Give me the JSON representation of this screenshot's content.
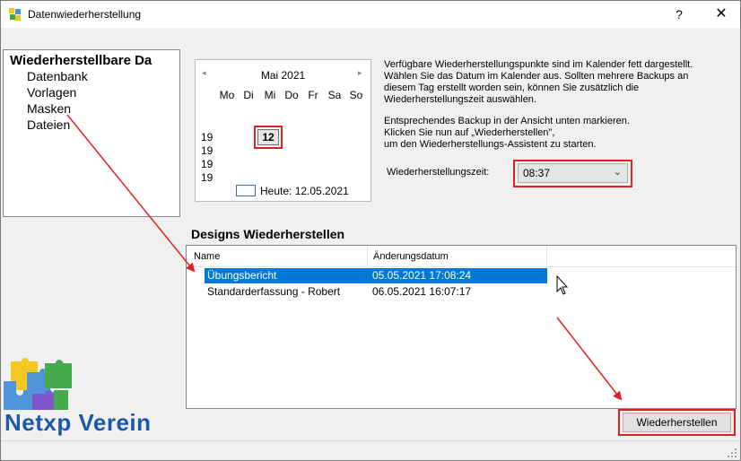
{
  "window": {
    "title": "Datenwiederherstellung",
    "help_glyph": "?",
    "close_glyph": "✕"
  },
  "tree": {
    "root": "Wiederherstellbare Da",
    "items": [
      "Datenbank",
      "Vorlagen",
      "Masken",
      "Dateien"
    ]
  },
  "calendar": {
    "month": "Mai 2021",
    "prev_glyph": "◂",
    "next_glyph": "▸",
    "weekdays": [
      "Mo",
      "Di",
      "Mi",
      "Do",
      "Fr",
      "Sa",
      "So"
    ],
    "week_numbers": [
      "19",
      "19",
      "19",
      "19"
    ],
    "selected_day": "12",
    "today_label": "Heute: 12.05.2021"
  },
  "info": {
    "para1": [
      "Verfügbare Wiederherstellungspunkte sind im Kalender fett dargestellt.",
      "Wählen Sie das Datum im Kalender aus. Sollten mehrere Backups an",
      "diesem Tag erstellt worden sein, können Sie zusätzlich die",
      "Wiederherstellungszeit auswählen."
    ],
    "para2": [
      "Entsprechendes Backup in der Ansicht unten markieren.",
      "Klicken Sie nun auf „Wiederherstellen\",",
      "um den Wiederherstellungs-Assistent zu starten."
    ]
  },
  "time": {
    "label": "Wiederherstellungszeit:",
    "value": "08:37",
    "arrow_glyph": "⌄"
  },
  "designs": {
    "title": "Designs Wiederherstellen",
    "columns": [
      "Name",
      "Änderungsdatum"
    ],
    "rows": [
      {
        "name": "Übungsbericht",
        "date": "05.05.2021 17:08:24",
        "selected": true
      },
      {
        "name": "Standarderfassung - Robert",
        "date": "06.05.2021 16:07:17",
        "selected": false
      }
    ]
  },
  "restore_button": "Wiederherstellen",
  "logo": {
    "text": "Netxp Verein",
    "colors": [
      "#f5c518",
      "#4a90d9",
      "#3aa845",
      "#7b4fc9"
    ]
  },
  "colors": {
    "highlight": "#e02020",
    "selection": "#0078d7"
  }
}
